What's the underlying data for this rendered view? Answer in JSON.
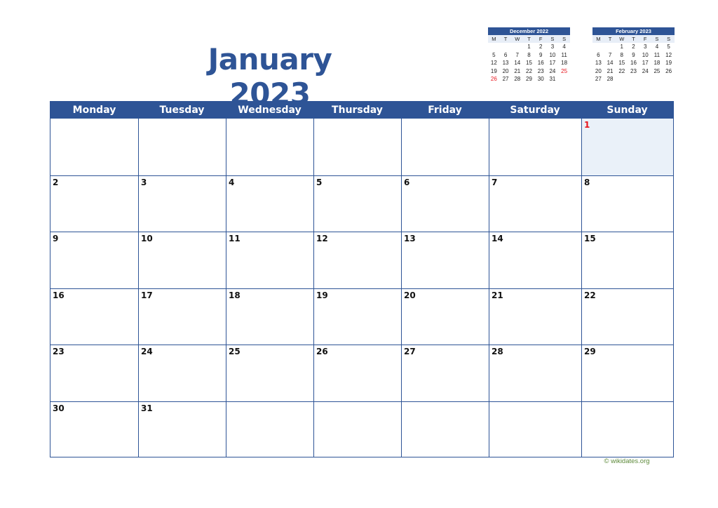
{
  "title": "January 2023",
  "weekdays": [
    "Monday",
    "Tuesday",
    "Wednesday",
    "Thursday",
    "Friday",
    "Saturday",
    "Sunday"
  ],
  "weeks": [
    [
      "",
      "",
      "",
      "",
      "",
      "",
      "1"
    ],
    [
      "2",
      "3",
      "4",
      "5",
      "6",
      "7",
      "8"
    ],
    [
      "9",
      "10",
      "11",
      "12",
      "13",
      "14",
      "15"
    ],
    [
      "16",
      "17",
      "18",
      "19",
      "20",
      "21",
      "22"
    ],
    [
      "23",
      "24",
      "25",
      "26",
      "27",
      "28",
      "29"
    ],
    [
      "30",
      "31",
      "",
      "",
      "",
      "",
      ""
    ]
  ],
  "holidays": [
    "1"
  ],
  "mini_calendars": [
    {
      "title": "December 2022",
      "dow": [
        "M",
        "T",
        "W",
        "T",
        "F",
        "S",
        "S"
      ],
      "weeks": [
        [
          "",
          "",
          "",
          "1",
          "2",
          "3",
          "4"
        ],
        [
          "5",
          "6",
          "7",
          "8",
          "9",
          "10",
          "11"
        ],
        [
          "12",
          "13",
          "14",
          "15",
          "16",
          "17",
          "18"
        ],
        [
          "19",
          "20",
          "21",
          "22",
          "23",
          "24",
          "25"
        ],
        [
          "26",
          "27",
          "28",
          "29",
          "30",
          "31",
          ""
        ]
      ],
      "red_days": [
        "25",
        "26"
      ]
    },
    {
      "title": "February 2023",
      "dow": [
        "M",
        "T",
        "W",
        "T",
        "F",
        "S",
        "S"
      ],
      "weeks": [
        [
          "",
          "",
          "1",
          "2",
          "3",
          "4",
          "5"
        ],
        [
          "6",
          "7",
          "8",
          "9",
          "10",
          "11",
          "12"
        ],
        [
          "13",
          "14",
          "15",
          "16",
          "17",
          "18",
          "19"
        ],
        [
          "20",
          "21",
          "22",
          "23",
          "24",
          "25",
          "26"
        ],
        [
          "27",
          "28",
          "",
          "",
          "",
          "",
          ""
        ]
      ],
      "red_days": []
    }
  ],
  "footer": "© wikidates.org",
  "colors": {
    "accent": "#2e5496",
    "holiday_text": "#e8141c",
    "holiday_bg": "#eaf1f9",
    "footer": "#5d8a3a"
  }
}
